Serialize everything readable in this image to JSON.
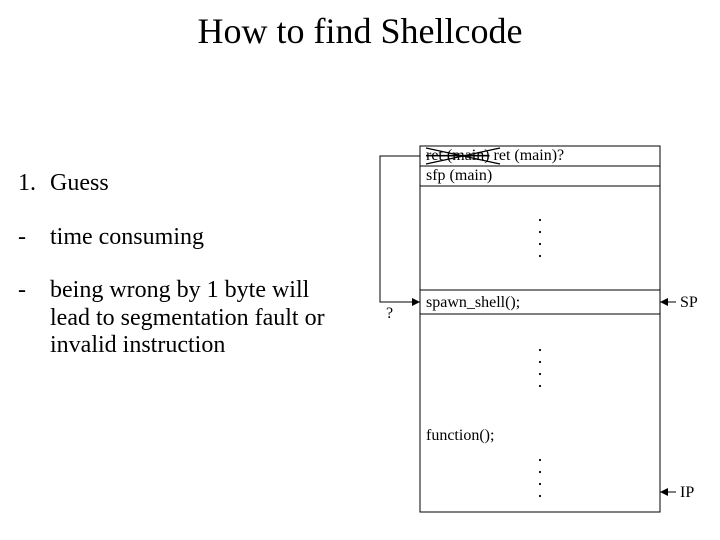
{
  "title": "How to find Shellcode",
  "bullets": {
    "b1_num": "1.",
    "b1_text": "Guess",
    "b2_dash": "-",
    "b2_text": "time consuming",
    "b3_dash": "-",
    "b3_text": "being wrong by 1 byte will lead to segmentation fault or invalid instruction"
  },
  "diagram": {
    "stack_row1_strike": "ret (main)",
    "stack_row1_right": " ret (main)?",
    "stack_row2": "sfp (main)",
    "stack_mid": "spawn_shell();",
    "stack_func": "function();",
    "arrow_question": "?",
    "label_sp": "SP",
    "label_ip": "IP"
  }
}
